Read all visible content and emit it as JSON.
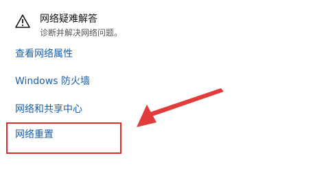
{
  "troubleshoot": {
    "title": "网络疑难解答",
    "description": "诊断并解决网络问题。",
    "icon": "warning-icon"
  },
  "links": {
    "network_properties": "查看网络属性",
    "firewall": "Windows 防火墙",
    "sharing_center": "网络和共享中心",
    "network_reset": "网络重置"
  },
  "colors": {
    "link": "#1a5fa8",
    "highlight": "#e02b2b",
    "arrow": "#e23b3b"
  }
}
